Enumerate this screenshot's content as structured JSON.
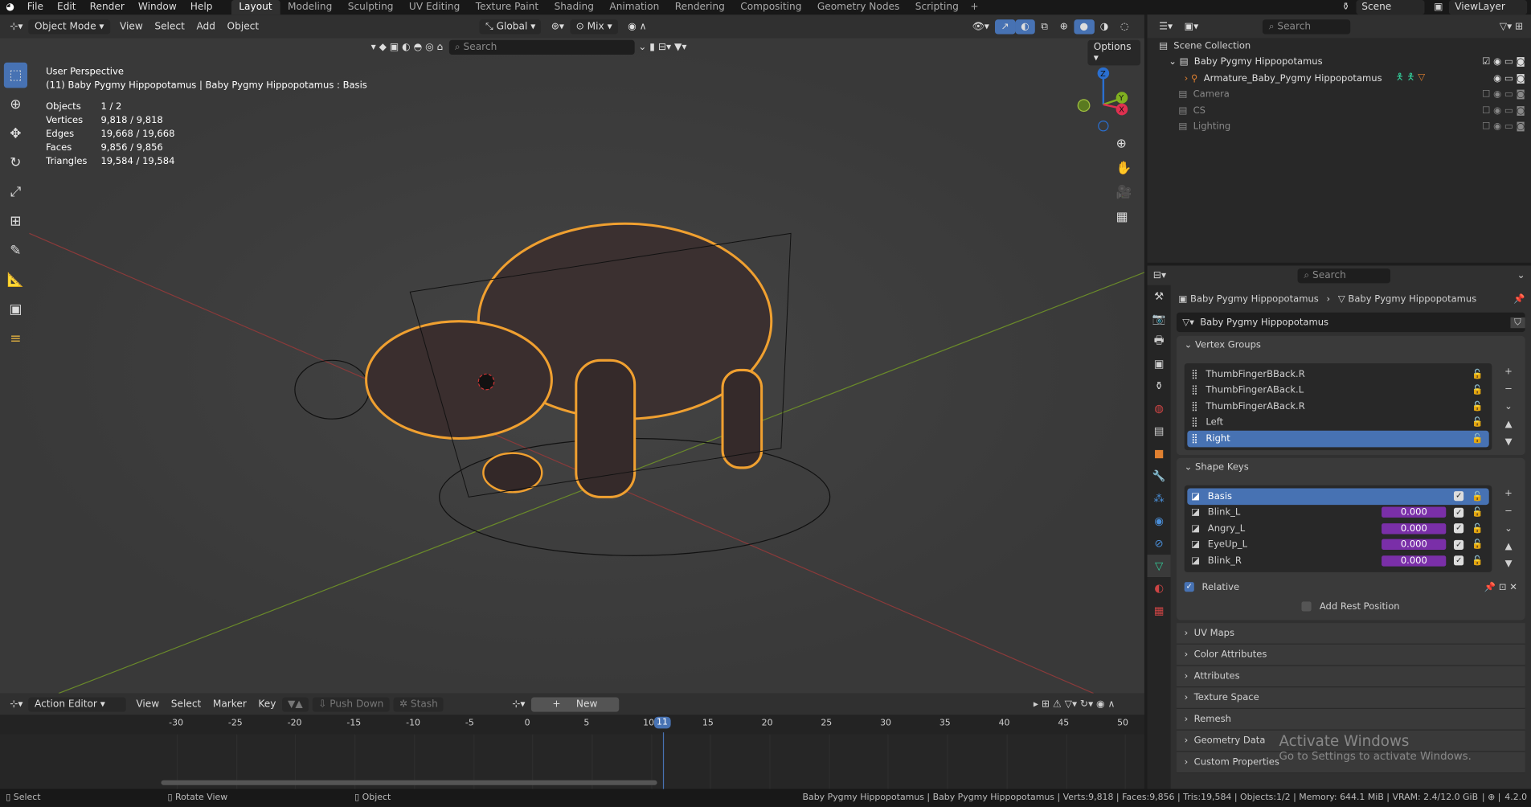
{
  "topbar": {
    "menus": [
      "File",
      "Edit",
      "Render",
      "Window",
      "Help"
    ],
    "workspaces": [
      "Layout",
      "Modeling",
      "Sculpting",
      "UV Editing",
      "Texture Paint",
      "Shading",
      "Animation",
      "Rendering",
      "Compositing",
      "Geometry Nodes",
      "Scripting"
    ],
    "active_workspace": "Layout",
    "scene": "Scene",
    "view_layer": "ViewLayer"
  },
  "viewport_header": {
    "mode": "Object Mode",
    "menus": [
      "View",
      "Select",
      "Add",
      "Object"
    ],
    "orientation": "Global",
    "pivot": "Mix",
    "search_placeholder": "Search",
    "options": "Options"
  },
  "overlay": {
    "perspective": "User Perspective",
    "object_line": "(11) Baby Pygmy Hippopotamus | Baby Pygmy Hippopotamus : Basis",
    "stats": [
      {
        "label": "Objects",
        "value": "1 / 2"
      },
      {
        "label": "Vertices",
        "value": "9,818 / 9,818"
      },
      {
        "label": "Edges",
        "value": "19,668 / 19,668"
      },
      {
        "label": "Faces",
        "value": "9,856 / 9,856"
      },
      {
        "label": "Triangles",
        "value": "19,584 / 19,584"
      }
    ]
  },
  "gizmo": {
    "x": "X",
    "y": "Y",
    "z": "Z"
  },
  "outliner": {
    "search_placeholder": "Search",
    "root": "Scene Collection",
    "items": [
      {
        "label": "Baby Pygmy Hippopotamus",
        "dim": false
      },
      {
        "label": "Armature_Baby_Pygmy Hippopotamus",
        "dim": false
      },
      {
        "label": "Camera",
        "dim": true
      },
      {
        "label": "CS",
        "dim": true
      },
      {
        "label": "Lighting",
        "dim": true
      }
    ]
  },
  "properties": {
    "search_placeholder": "Search",
    "breadcrumb": [
      "Baby Pygmy Hippopotamus",
      "Baby Pygmy Hippopotamus"
    ],
    "mesh_name": "Baby Pygmy Hippopotamus",
    "vertex_groups": {
      "title": "Vertex Groups",
      "items": [
        "ThumbFingerBBack.R",
        "ThumbFingerABack.L",
        "ThumbFingerABack.R",
        "Left",
        "Right"
      ],
      "selected": "Right"
    },
    "shape_keys": {
      "title": "Shape Keys",
      "items": [
        {
          "name": "Basis",
          "value": null
        },
        {
          "name": "Blink_L",
          "value": "0.000"
        },
        {
          "name": "Angry_L",
          "value": "0.000"
        },
        {
          "name": "EyeUp_L",
          "value": "0.000"
        },
        {
          "name": "Blink_R",
          "value": "0.000"
        }
      ],
      "relative": "Relative",
      "add_rest": "Add Rest Position"
    },
    "sections": [
      "UV Maps",
      "Color Attributes",
      "Attributes",
      "Texture Space",
      "Remesh",
      "Geometry Data",
      "Custom Properties"
    ]
  },
  "action_editor": {
    "mode": "Action Editor",
    "menus": [
      "View",
      "Select",
      "Marker",
      "Key"
    ],
    "push_down": "Push Down",
    "stash": "Stash",
    "new": "New",
    "ticks": [
      "-30",
      "-25",
      "-20",
      "-15",
      "-10",
      "-5",
      "0",
      "5",
      "10",
      "15",
      "20",
      "25",
      "30",
      "35",
      "40",
      "45",
      "50"
    ],
    "current_frame": "11"
  },
  "watermark": {
    "title": "Activate Windows",
    "subtitle": "Go to Settings to activate Windows."
  },
  "status": {
    "select": "Select",
    "rotate": "Rotate View",
    "object": "Object",
    "info": "Baby Pygmy Hippopotamus | Baby Pygmy Hippopotamus | Verts:9,818 | Faces:9,856 | Tris:19,584 | Objects:1/2 | Memory: 644.1 MiB | VRAM: 2.4/12.0 GiB",
    "version": "4.2.0"
  }
}
